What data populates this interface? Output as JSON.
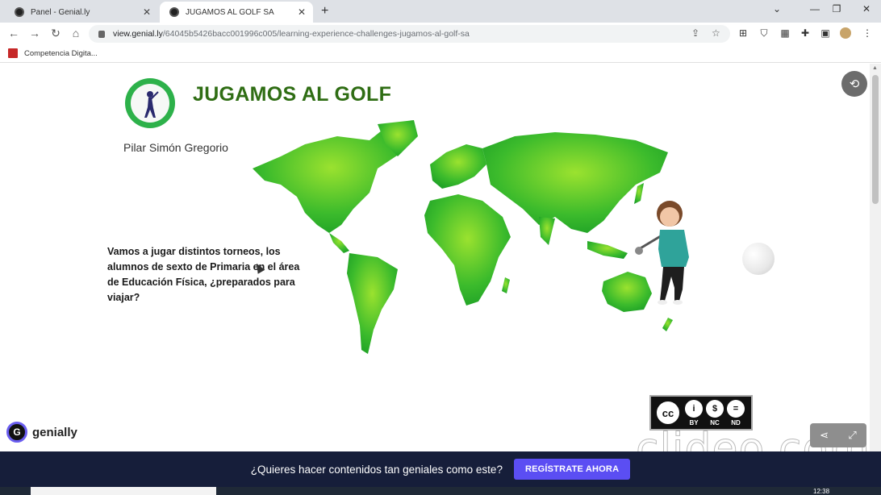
{
  "browser": {
    "tabs": [
      {
        "label": "Panel - Genial.ly",
        "active": false
      },
      {
        "label": "JUGAMOS AL GOLF SA",
        "active": true
      }
    ],
    "new_tab_icon": "plus-icon",
    "url_main": "view.genial.ly",
    "url_rest": "/64045b5426bacc001996c005/learning-experience-challenges-jugamos-al-golf-sa",
    "bookmark": "Competencia Digita...",
    "window_controls": [
      "minimize-icon",
      "maximize-icon",
      "close-icon"
    ]
  },
  "page": {
    "title": "JUGAMOS AL GOLF",
    "author": "Pilar Simón Gregorio",
    "description": "Vamos a jugar distintos torneos, los alumnos de sexto de Primaria en el área de Educación Física, ¿preparados para viajar?",
    "license": {
      "main": "cc",
      "labels": [
        "BY",
        "NC",
        "ND"
      ]
    },
    "brand": "genially",
    "watermark": "clideo.com"
  },
  "cta": {
    "text": "¿Quieres hacer contenidos tan geniales como este?",
    "button": "REGÍSTRATE AHORA"
  },
  "taskbar": {
    "clock": "12:38"
  },
  "colors": {
    "title_green": "#2f6d14",
    "map_green": "#34b233",
    "cta_background": "#161e3a",
    "cta_button": "#5b4ef3"
  }
}
